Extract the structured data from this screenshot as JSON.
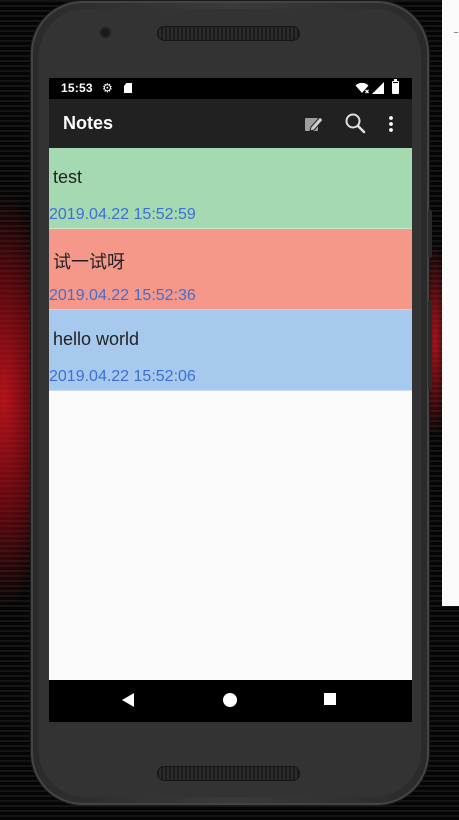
{
  "status_bar": {
    "time": "15:53",
    "icons": [
      "gear-icon",
      "sd-card-icon",
      "wifi-icon",
      "signal-icon",
      "battery-icon"
    ]
  },
  "app_bar": {
    "title": "Notes",
    "actions": [
      "edit-note-icon",
      "search-icon",
      "more-vert-icon"
    ]
  },
  "notes": [
    {
      "title": "test",
      "date": "2019.04.22 15:52:59",
      "color": "#a5d9b1"
    },
    {
      "title": "试一试呀",
      "date": "2019.04.22 15:52:36",
      "color": "#f5988a"
    },
    {
      "title": "hello world",
      "date": "2019.04.22 15:52:06",
      "color": "#a6c9ed"
    }
  ],
  "nav_bar": {
    "buttons": [
      "back-icon",
      "home-icon",
      "recents-icon"
    ]
  },
  "colors": {
    "toolbar": "#212121",
    "date_text": "#3d6fd6",
    "screen_bg": "#fafafa"
  }
}
